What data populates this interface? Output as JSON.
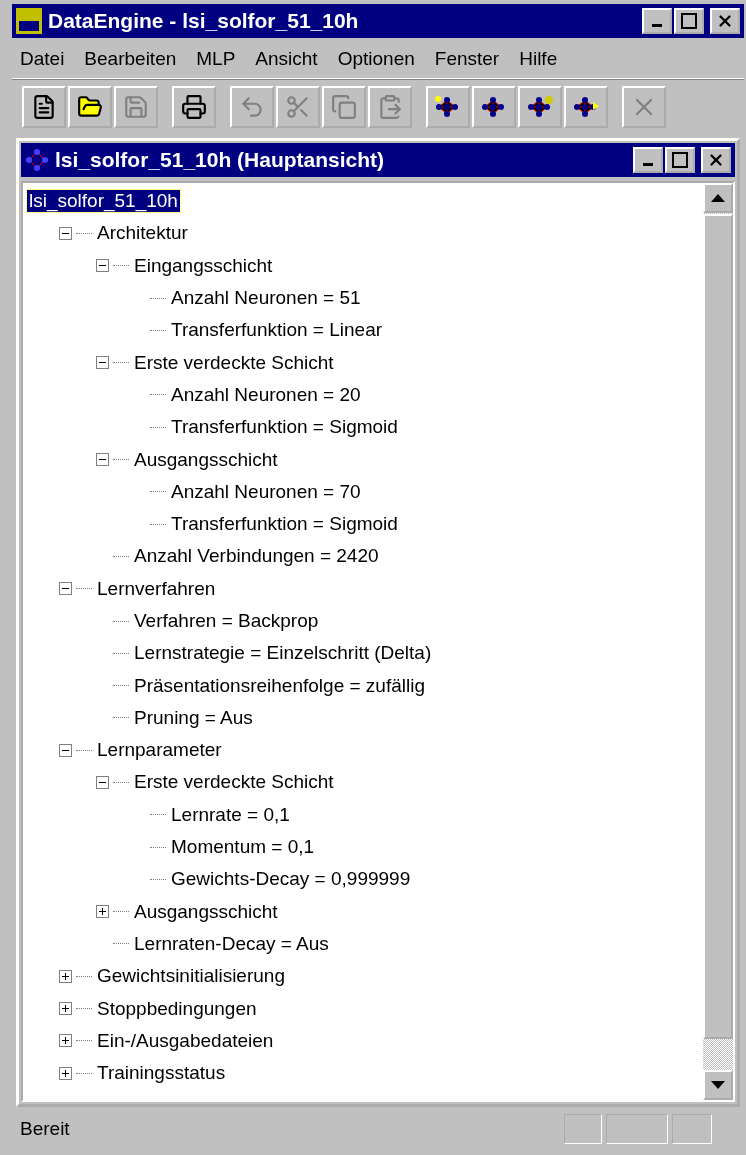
{
  "window": {
    "title": "DataEngine - lsi_solfor_51_10h"
  },
  "menu": [
    "Datei",
    "Bearbeiten",
    "MLP",
    "Ansicht",
    "Optionen",
    "Fenster",
    "Hilfe"
  ],
  "toolbar": [
    [
      {
        "kind": "new",
        "disabled": false
      },
      {
        "kind": "open",
        "disabled": false
      },
      {
        "kind": "save",
        "disabled": true
      }
    ],
    [
      {
        "kind": "print",
        "disabled": false
      }
    ],
    [
      {
        "kind": "undo",
        "disabled": true
      },
      {
        "kind": "cut",
        "disabled": true
      },
      {
        "kind": "copy",
        "disabled": true
      },
      {
        "kind": "paste",
        "disabled": true
      }
    ],
    [
      {
        "kind": "net-new",
        "disabled": false
      },
      {
        "kind": "net",
        "disabled": false
      },
      {
        "kind": "net-query",
        "disabled": false
      },
      {
        "kind": "net-run",
        "disabled": false
      }
    ],
    [
      {
        "kind": "stop",
        "disabled": true
      }
    ]
  ],
  "child_window": {
    "title": "lsi_solfor_51_10h (Hauptansicht)"
  },
  "tree": {
    "label": "lsi_solfor_51_10h",
    "selected": true,
    "children": [
      {
        "label": "Architektur",
        "selected": false,
        "expanded": true,
        "children": [
          {
            "label": "Eingangsschicht",
            "selected": false,
            "expanded": true,
            "children": [
              {
                "label": "Anzahl Neuronen = 51",
                "selected": false
              },
              {
                "label": "Transferfunktion = Linear",
                "selected": false
              }
            ]
          },
          {
            "label": "Erste verdeckte Schicht",
            "selected": false,
            "expanded": true,
            "children": [
              {
                "label": "Anzahl Neuronen = 20",
                "selected": false
              },
              {
                "label": "Transferfunktion = Sigmoid",
                "selected": false
              }
            ]
          },
          {
            "label": "Ausgangsschicht",
            "selected": false,
            "expanded": true,
            "children": [
              {
                "label": "Anzahl Neuronen = 70",
                "selected": false
              },
              {
                "label": "Transferfunktion = Sigmoid",
                "selected": false
              }
            ]
          },
          {
            "label": "Anzahl Verbindungen = 2420",
            "selected": false
          }
        ]
      },
      {
        "label": "Lernverfahren",
        "selected": false,
        "expanded": true,
        "children": [
          {
            "label": "Verfahren = Backprop",
            "selected": false
          },
          {
            "label": "Lernstrategie = Einzelschritt (Delta)",
            "selected": false
          },
          {
            "label": "Präsentationsreihenfolge = zufällig",
            "selected": false
          },
          {
            "label": "Pruning = Aus",
            "selected": false
          }
        ]
      },
      {
        "label": "Lernparameter",
        "selected": false,
        "expanded": true,
        "children": [
          {
            "label": "Erste verdeckte Schicht",
            "selected": false,
            "expanded": true,
            "children": [
              {
                "label": "Lernrate = 0,1",
                "selected": false
              },
              {
                "label": "Momentum = 0,1",
                "selected": false
              },
              {
                "label": "Gewichts-Decay = 0,999999",
                "selected": false
              }
            ]
          },
          {
            "label": "Ausgangsschicht",
            "selected": false,
            "expanded": false
          },
          {
            "label": "Lernraten-Decay = Aus",
            "selected": false
          }
        ]
      },
      {
        "label": "Gewichtsinitialisierung",
        "selected": false,
        "expanded": false
      },
      {
        "label": "Stoppbedingungen",
        "selected": false,
        "expanded": false
      },
      {
        "label": "Ein-/Ausgabedateien",
        "selected": false,
        "expanded": false
      },
      {
        "label": "Trainingsstatus",
        "selected": false,
        "expanded": false
      }
    ]
  },
  "status_bar": {
    "text": "Bereit"
  }
}
